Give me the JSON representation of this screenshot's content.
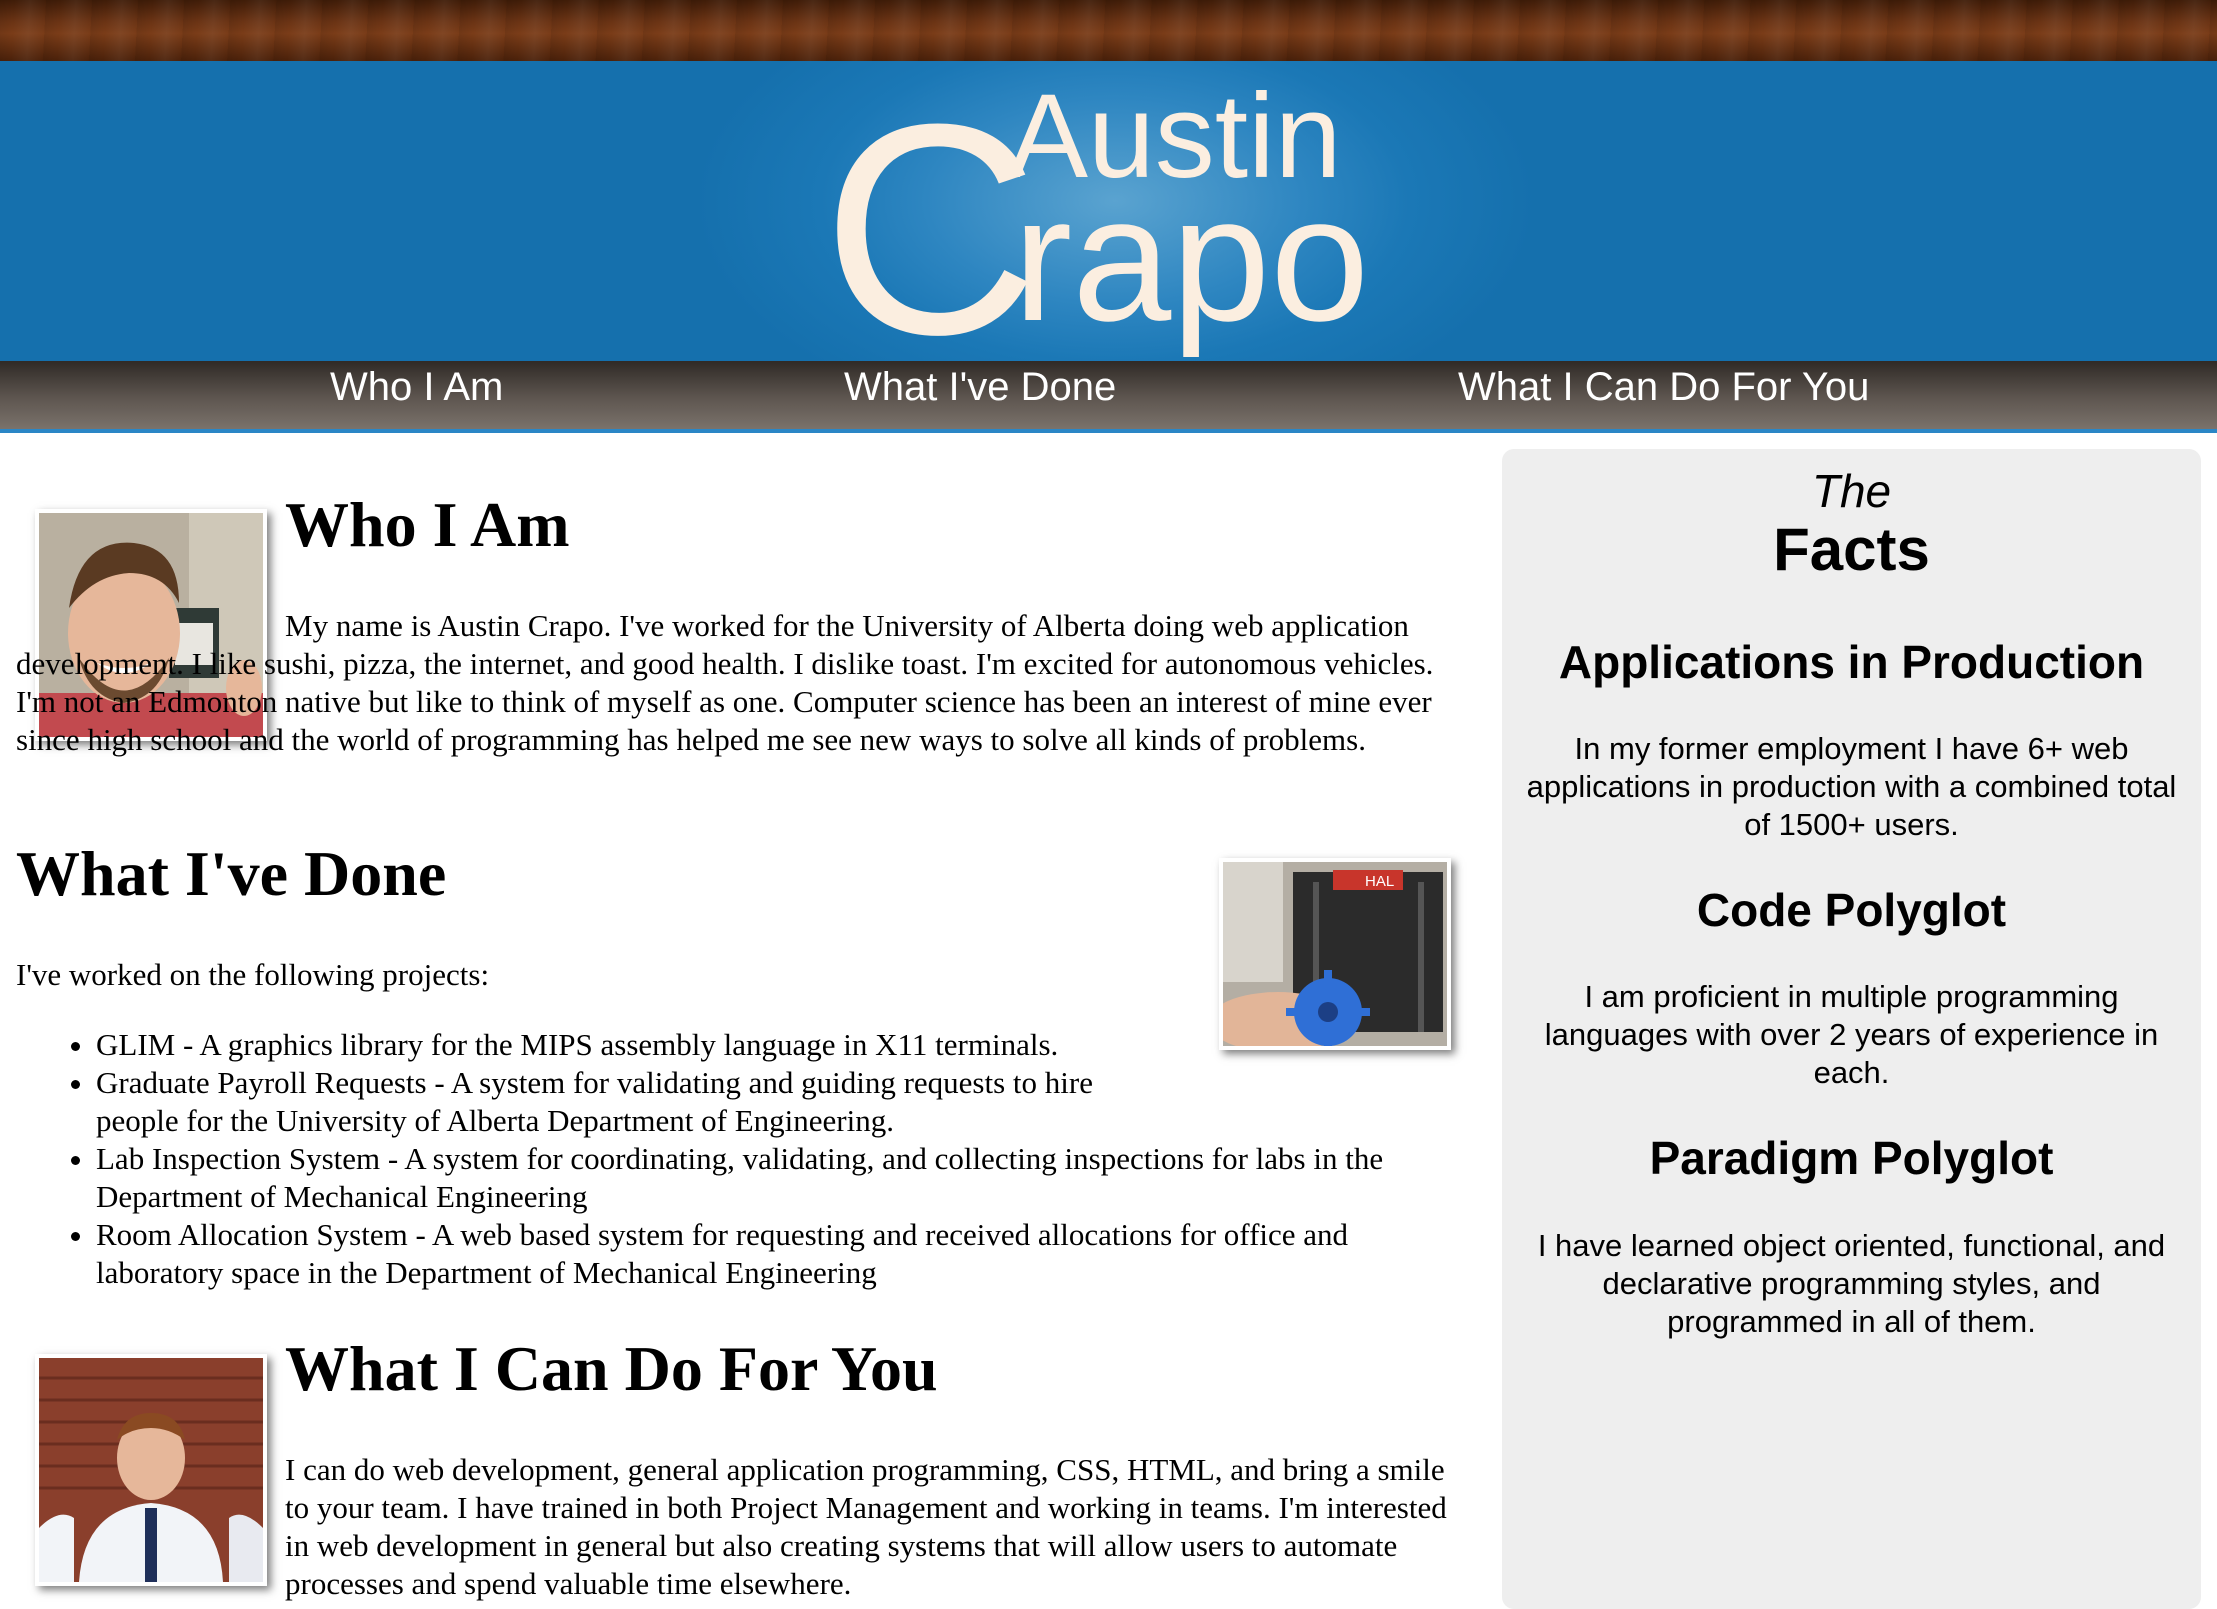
{
  "header": {
    "logo_c": "C",
    "logo_first": "Austin",
    "logo_rest": "rapo"
  },
  "nav": {
    "items": [
      {
        "label": "Who I Am"
      },
      {
        "label": "What I've Done"
      },
      {
        "label": "What I Can Do For You"
      }
    ]
  },
  "who": {
    "heading": "Who I Am",
    "body": "My name is Austin Crapo. I've worked for the University of Alberta doing web application development. I like sushi, pizza, the internet, and good health. I dislike toast. I'm excited for autonomous vehicles. I'm not an Edmonton native but like to think of myself as one. Computer science has been an interest of mine ever since high school and the world of programming has helped me see new ways to solve all kinds of problems."
  },
  "done": {
    "heading": "What I've Done",
    "intro": "I've worked on the following projects:",
    "projects": [
      "GLIM - A graphics library for the MIPS assembly language in X11 terminals.",
      "Graduate Payroll Requests - A system for validating and guiding requests to hire people for the University of Alberta Department of Engineering.",
      "Lab Inspection System - A system for coordinating, validating, and collecting inspections for labs in the Department of Mechanical Engineering",
      "Room Allocation System - A web based system for requesting and received allocations for office and laboratory space in the Department of Mechanical Engineering"
    ],
    "photo_sign": "HAL"
  },
  "cando": {
    "heading": "What I Can Do For You",
    "body": "I can do web development, general application programming, CSS, HTML, and bring a smile to your team. I have trained in both Project Management and working in teams. I'm interested in web development in general but also creating systems that will allow users to automate processes and spend valuable time elsewhere."
  },
  "sidebar": {
    "the": "The",
    "facts": "Facts",
    "sections": [
      {
        "heading": "Applications in Production",
        "body": "In my former employment I have 6+ web applications in production with a combined total of 1500+ users."
      },
      {
        "heading": "Code Polyglot",
        "body": "I am proficient in multiple programming languages with over 2 years of experience in each."
      },
      {
        "heading": "Paradigm Polyglot",
        "body": "I have learned object oriented, functional, and declarative programming styles, and programmed in all of them."
      }
    ]
  },
  "colors": {
    "banner_blue": "#1b78b6",
    "nav_accent": "#2a86c6",
    "logo_text": "#fbeee0",
    "sidebar_bg": "#eeeeee"
  }
}
